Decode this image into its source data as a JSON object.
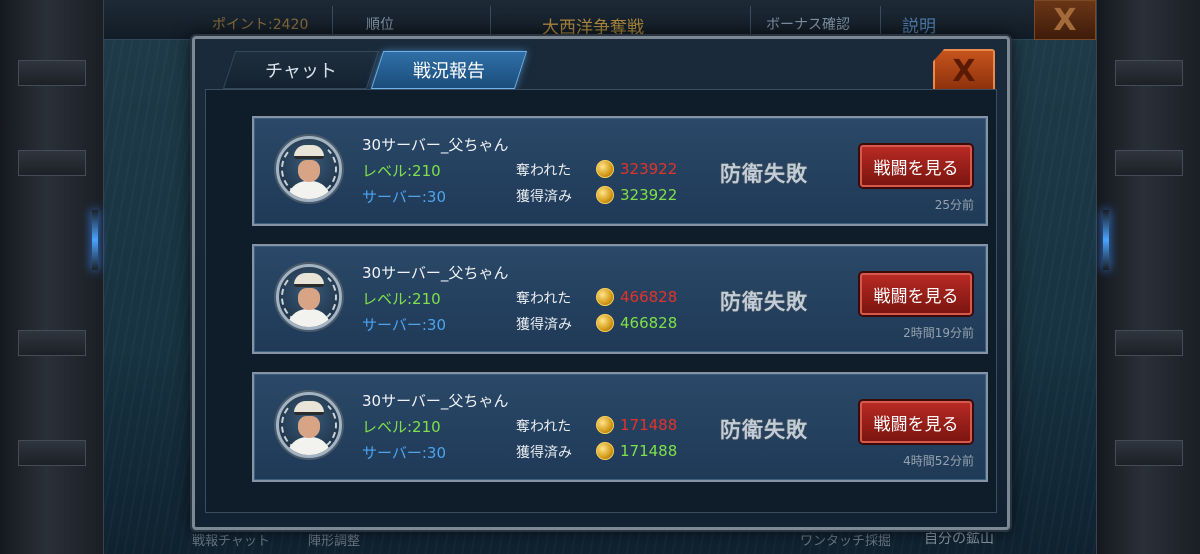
{
  "topbar": {
    "points": "ポイント:2420",
    "rank": "順位",
    "event_title": "大西洋争奪戦",
    "bonus": "ボーナス確認",
    "help": "説明",
    "close": "X"
  },
  "bottombar": {
    "battle_chat": "戦報チャット",
    "formation": "陣形調整",
    "one_touch": "ワンタッチ採掘",
    "my_mine": "自分の鉱山"
  },
  "modal": {
    "tabs": [
      {
        "label": "チャット",
        "active": false
      },
      {
        "label": "戦況報告",
        "active": true
      }
    ],
    "close_label": "X"
  },
  "reports": [
    {
      "player_name": "30サーバー_父ちゃん",
      "level": "レベル:210",
      "server": "サーバー:30",
      "lost_label": "奪われた",
      "lost_amount": "323922",
      "gained_label": "獲得済み",
      "gained_amount": "323922",
      "result": "防衛失敗",
      "button": "戦闘を見る",
      "time_ago": "25分前"
    },
    {
      "player_name": "30サーバー_父ちゃん",
      "level": "レベル:210",
      "server": "サーバー:30",
      "lost_label": "奪われた",
      "lost_amount": "466828",
      "gained_label": "獲得済み",
      "gained_amount": "466828",
      "result": "防衛失敗",
      "button": "戦闘を見る",
      "time_ago": "2時間19分前"
    },
    {
      "player_name": "30サーバー_父ちゃん",
      "level": "レベル:210",
      "server": "サーバー:30",
      "lost_label": "奪われた",
      "lost_amount": "171488",
      "gained_label": "獲得済み",
      "gained_amount": "171488",
      "result": "防衛失敗",
      "button": "戦闘を見る",
      "time_ago": "4時間52分前"
    }
  ],
  "colors": {
    "lost": "#e2332b",
    "gained": "#7fe04a",
    "level": "#7fe04a",
    "server": "#4da3ee",
    "active_tab": "#2f6fa7",
    "watch_button": "#b62a23",
    "close_button": "#c6541c"
  },
  "icons": {
    "avatar": "naval-officer-avatar",
    "currency": "gold-coin-icon"
  }
}
